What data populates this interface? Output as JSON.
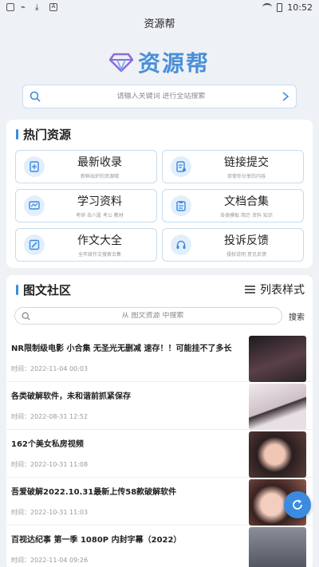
{
  "status_bar": {
    "time": "10:52",
    "icons": [
      "app-icon",
      "usb-icon",
      "download-icon",
      "a-icon",
      "wifi-icon",
      "battery-icon"
    ]
  },
  "app": {
    "title": "资源帮",
    "logo_text": "资源帮",
    "logo_icon": "diamond-icon",
    "accent": "#3b8be0"
  },
  "search": {
    "placeholder": "请输入关键词 进行全站搜索"
  },
  "hot": {
    "title": "热门资源",
    "items": [
      {
        "label": "最新收录",
        "sub": "新鲜出炉的资源哦",
        "icon": "new-doc-icon"
      },
      {
        "label": "链接提交",
        "sub": "崇倚你分享的内容",
        "icon": "link-submit-icon"
      },
      {
        "label": "学习资料",
        "sub": "考研 去八股 考公 教材",
        "icon": "study-icon"
      },
      {
        "label": "文档合集",
        "sub": "各类模板 简历 资料 知识",
        "icon": "doc-collection-icon"
      },
      {
        "label": "作文大全",
        "sub": "全年级作文搜索合集",
        "icon": "essay-icon"
      },
      {
        "label": "投诉反馈",
        "sub": "侵权说明 意见反馈",
        "icon": "headset-icon"
      }
    ]
  },
  "community": {
    "title": "图文社区",
    "list_mode_label": "列表样式",
    "search_placeholder": "从 图文资源 中搜索",
    "search_button": "搜索",
    "posts": [
      {
        "title": "NR限制级电影 小合集 无圣光无删减 速存！！可能挂不了多长",
        "time": "时间：2022-11-04 00:03",
        "thumb_color": "#3a2b30"
      },
      {
        "title": "各类破解软件，未和谐前抓紧保存",
        "time": "时间：2022-08-31 12:52",
        "thumb_color": "#d9ccd3"
      },
      {
        "title": "162个美女私房视频",
        "time": "时间：2022-10-31 11:08",
        "thumb_color": "#c88a78"
      },
      {
        "title": "吾爱破解2022.10.31最新上传58款破解软件",
        "time": "时间：2022-10-31 11:03",
        "thumb_color": "#b07060"
      },
      {
        "title": "百视达纪事 第一季 1080P 内封字幕（2022）",
        "time": "时间：2022-11-04 09:26",
        "thumb_color": "#6b6f7a"
      }
    ]
  }
}
